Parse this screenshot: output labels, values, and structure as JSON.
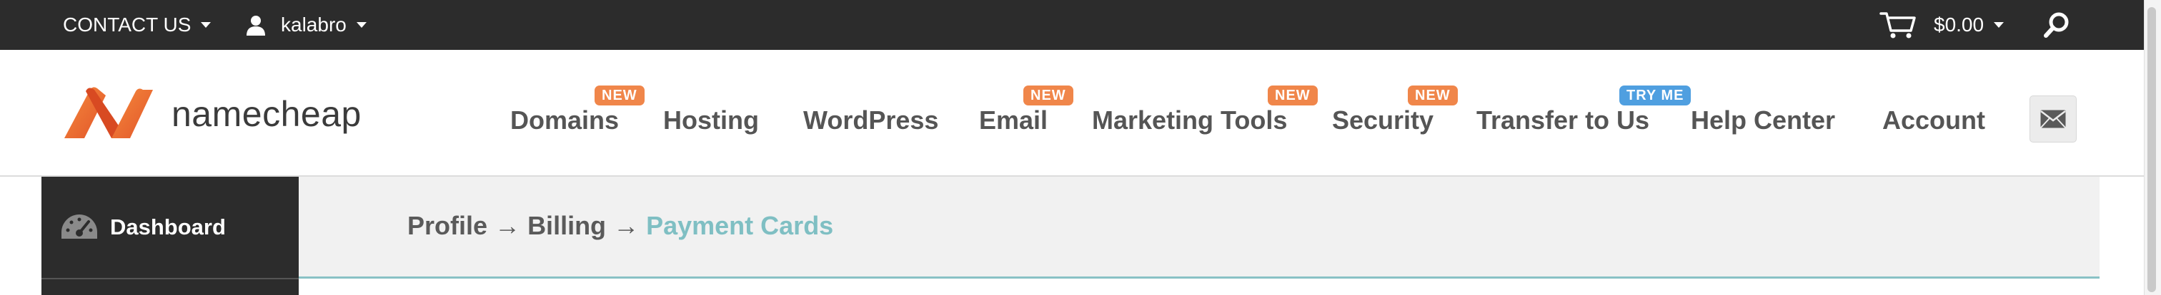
{
  "topbar": {
    "contact_label": "CONTACT US",
    "username": "kalabro",
    "cart_total": "$0.00"
  },
  "brand": {
    "logo_text": "namecheap",
    "logo_color": "#f26b3a"
  },
  "nav": {
    "items": [
      {
        "label": "Domains",
        "badge": "NEW"
      },
      {
        "label": "Hosting",
        "badge": ""
      },
      {
        "label": "WordPress",
        "badge": ""
      },
      {
        "label": "Email",
        "badge": "NEW"
      },
      {
        "label": "Marketing Tools",
        "badge": "NEW"
      },
      {
        "label": "Security",
        "badge": "NEW"
      },
      {
        "label": "Transfer to Us",
        "badge": "TRY ME"
      },
      {
        "label": "Help Center",
        "badge": ""
      },
      {
        "label": "Account",
        "badge": ""
      }
    ],
    "badge_new_color": "#f0864a",
    "badge_try_color": "#4f9fe0",
    "messages_icon": "envelope-icon"
  },
  "sidebar": {
    "items": [
      {
        "label": "Dashboard",
        "icon": "speedometer-icon"
      }
    ]
  },
  "breadcrumb": {
    "items": [
      "Profile",
      "Billing",
      "Payment Cards"
    ],
    "separator": "→",
    "active_color": "#7fbfc3"
  }
}
